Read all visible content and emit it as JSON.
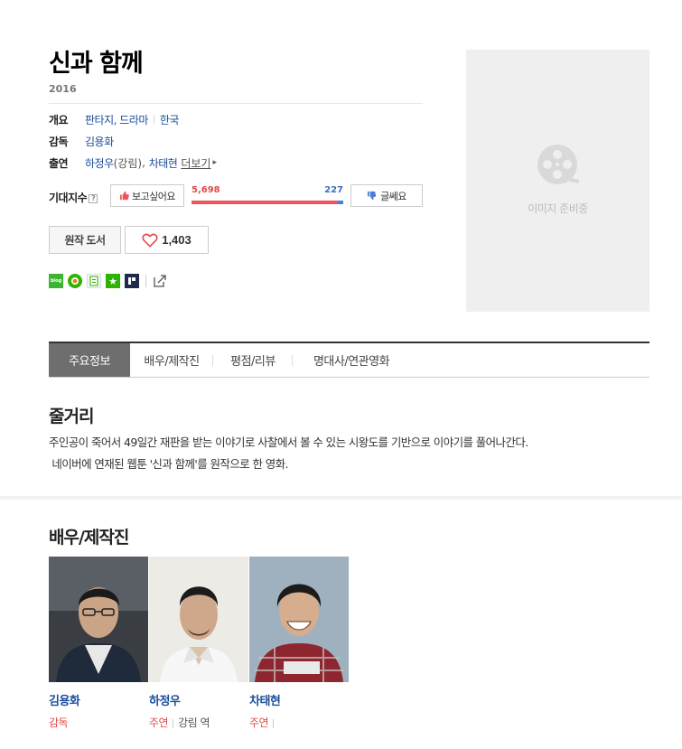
{
  "movie": {
    "title": "신과 함께",
    "year": "2016",
    "info": {
      "overview_label": "개요",
      "genre": "판타지, 드라마",
      "country": "한국",
      "director_label": "감독",
      "director": "김용화",
      "cast_label": "출연",
      "cast_1": "하정우",
      "cast_1_role": "(강림)",
      "cast_2": "차태현",
      "more": "더보기"
    },
    "expect": {
      "label": "기대지수",
      "help": "?",
      "want_label": "보고싶어요",
      "want_count": "5,698",
      "nope_count": "227",
      "want_ratio": 0.962,
      "nope_label": "글쎄요"
    },
    "original_book_label": "원작 도서",
    "likes": "1,403",
    "share": {
      "blog": "blog",
      "icons": [
        "blog-icon",
        "cafe-icon",
        "memo-icon",
        "bookmark-star-icon",
        "band-icon",
        "external-share-icon"
      ]
    },
    "poster_placeholder": "이미지 준비중"
  },
  "tabs": [
    {
      "label": "주요정보",
      "active": true
    },
    {
      "label": "배우/제작진",
      "active": false
    },
    {
      "label": "평점/리뷰",
      "active": false
    },
    {
      "label": "명대사/연관영화",
      "active": false
    }
  ],
  "synopsis": {
    "heading": "줄거리",
    "line1": "주인공이 죽어서 49일간 재판을 받는 이야기로 사찰에서 볼 수 있는 시왕도를 기반으로 이야기를 풀어나간다.",
    "line2": " 네이버에 연재된 웹툰 '신과 함께'를 원작으로 한 영화."
  },
  "crew": {
    "heading": "배우/제작진",
    "people": [
      {
        "name": "김용화",
        "role": "감독",
        "character": ""
      },
      {
        "name": "하정우",
        "role": "주연",
        "character": "강림 역"
      },
      {
        "name": "차태현",
        "role": "주연",
        "character": ""
      }
    ]
  },
  "colors": {
    "link": "#1a4d9c",
    "want": "#f2525a",
    "nope": "#4a7fd6",
    "active_tab": "#6e6e6e"
  }
}
